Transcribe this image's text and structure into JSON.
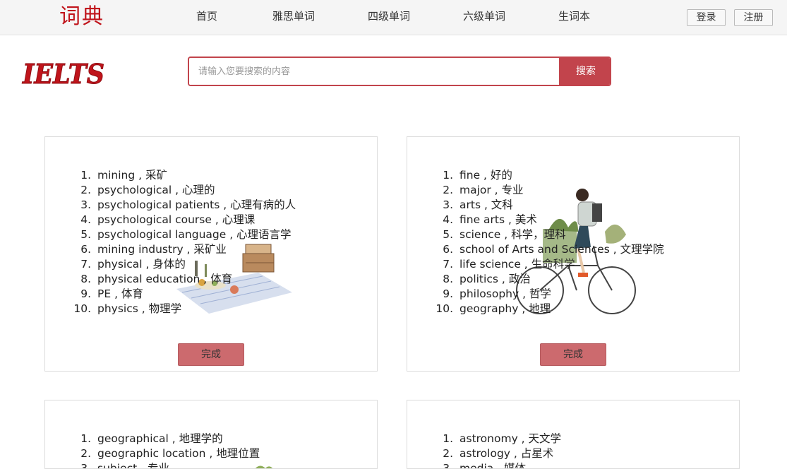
{
  "navbar": {
    "brand": "词典",
    "items": [
      {
        "label": "首页"
      },
      {
        "label": "雅思单词"
      },
      {
        "label": "四级单词"
      },
      {
        "label": "六级单词"
      },
      {
        "label": "生词本"
      }
    ],
    "login_label": "登录",
    "register_label": "注册"
  },
  "logo": {
    "text": "IELTS"
  },
  "search": {
    "placeholder": "请输入您要搜索的内容",
    "value": "",
    "button_label": "搜索"
  },
  "cards": [
    {
      "illustration": "picnic-illustration",
      "words": [
        {
          "num": "1.",
          "text": "mining , 采矿"
        },
        {
          "num": "2.",
          "text": "psychological , 心理的"
        },
        {
          "num": "3.",
          "text": "psychological patients , 心理有病的人"
        },
        {
          "num": "4.",
          "text": "psychological course , 心理课"
        },
        {
          "num": "5.",
          "text": "psychological language , 心理语言学"
        },
        {
          "num": "6.",
          "text": "mining industry , 采矿业"
        },
        {
          "num": "7.",
          "text": "physical , 身体的"
        },
        {
          "num": "8.",
          "text": "physical education , 体育"
        },
        {
          "num": "9.",
          "text": "PE , 体育"
        },
        {
          "num": "10.",
          "text": "physics , 物理学"
        }
      ],
      "done_label": "完成"
    },
    {
      "illustration": "bicycle-illustration",
      "words": [
        {
          "num": "1.",
          "text": "fine , 好的"
        },
        {
          "num": "2.",
          "text": "major , 专业"
        },
        {
          "num": "3.",
          "text": "arts , 文科"
        },
        {
          "num": "4.",
          "text": "fine arts , 美术"
        },
        {
          "num": "5.",
          "text": "science , 科学，理科"
        },
        {
          "num": "6.",
          "text": "school of Arts and Sciences , 文理学院"
        },
        {
          "num": "7.",
          "text": "life science , 生命科学"
        },
        {
          "num": "8.",
          "text": "politics , 政治"
        },
        {
          "num": "9.",
          "text": "philosophy , 哲学"
        },
        {
          "num": "10.",
          "text": "geography , 地理"
        }
      ],
      "done_label": "完成"
    },
    {
      "illustration": "plant-illustration",
      "words": [
        {
          "num": "1.",
          "text": "geographical , 地理学的"
        },
        {
          "num": "2.",
          "text": "geographic location , 地理位置"
        },
        {
          "num": "3.",
          "text": "subject , 专业"
        }
      ]
    },
    {
      "illustration": "",
      "words": [
        {
          "num": "1.",
          "text": "astronomy , 天文学"
        },
        {
          "num": "2.",
          "text": "astrology , 占星术"
        },
        {
          "num": "3.",
          "text": "media , 媒体"
        }
      ]
    }
  ],
  "colors": {
    "brand_red": "#c0141b",
    "accent": "#c2444c",
    "done_button": "#cc6a6e",
    "navbar_bg": "#f5f5f5"
  }
}
